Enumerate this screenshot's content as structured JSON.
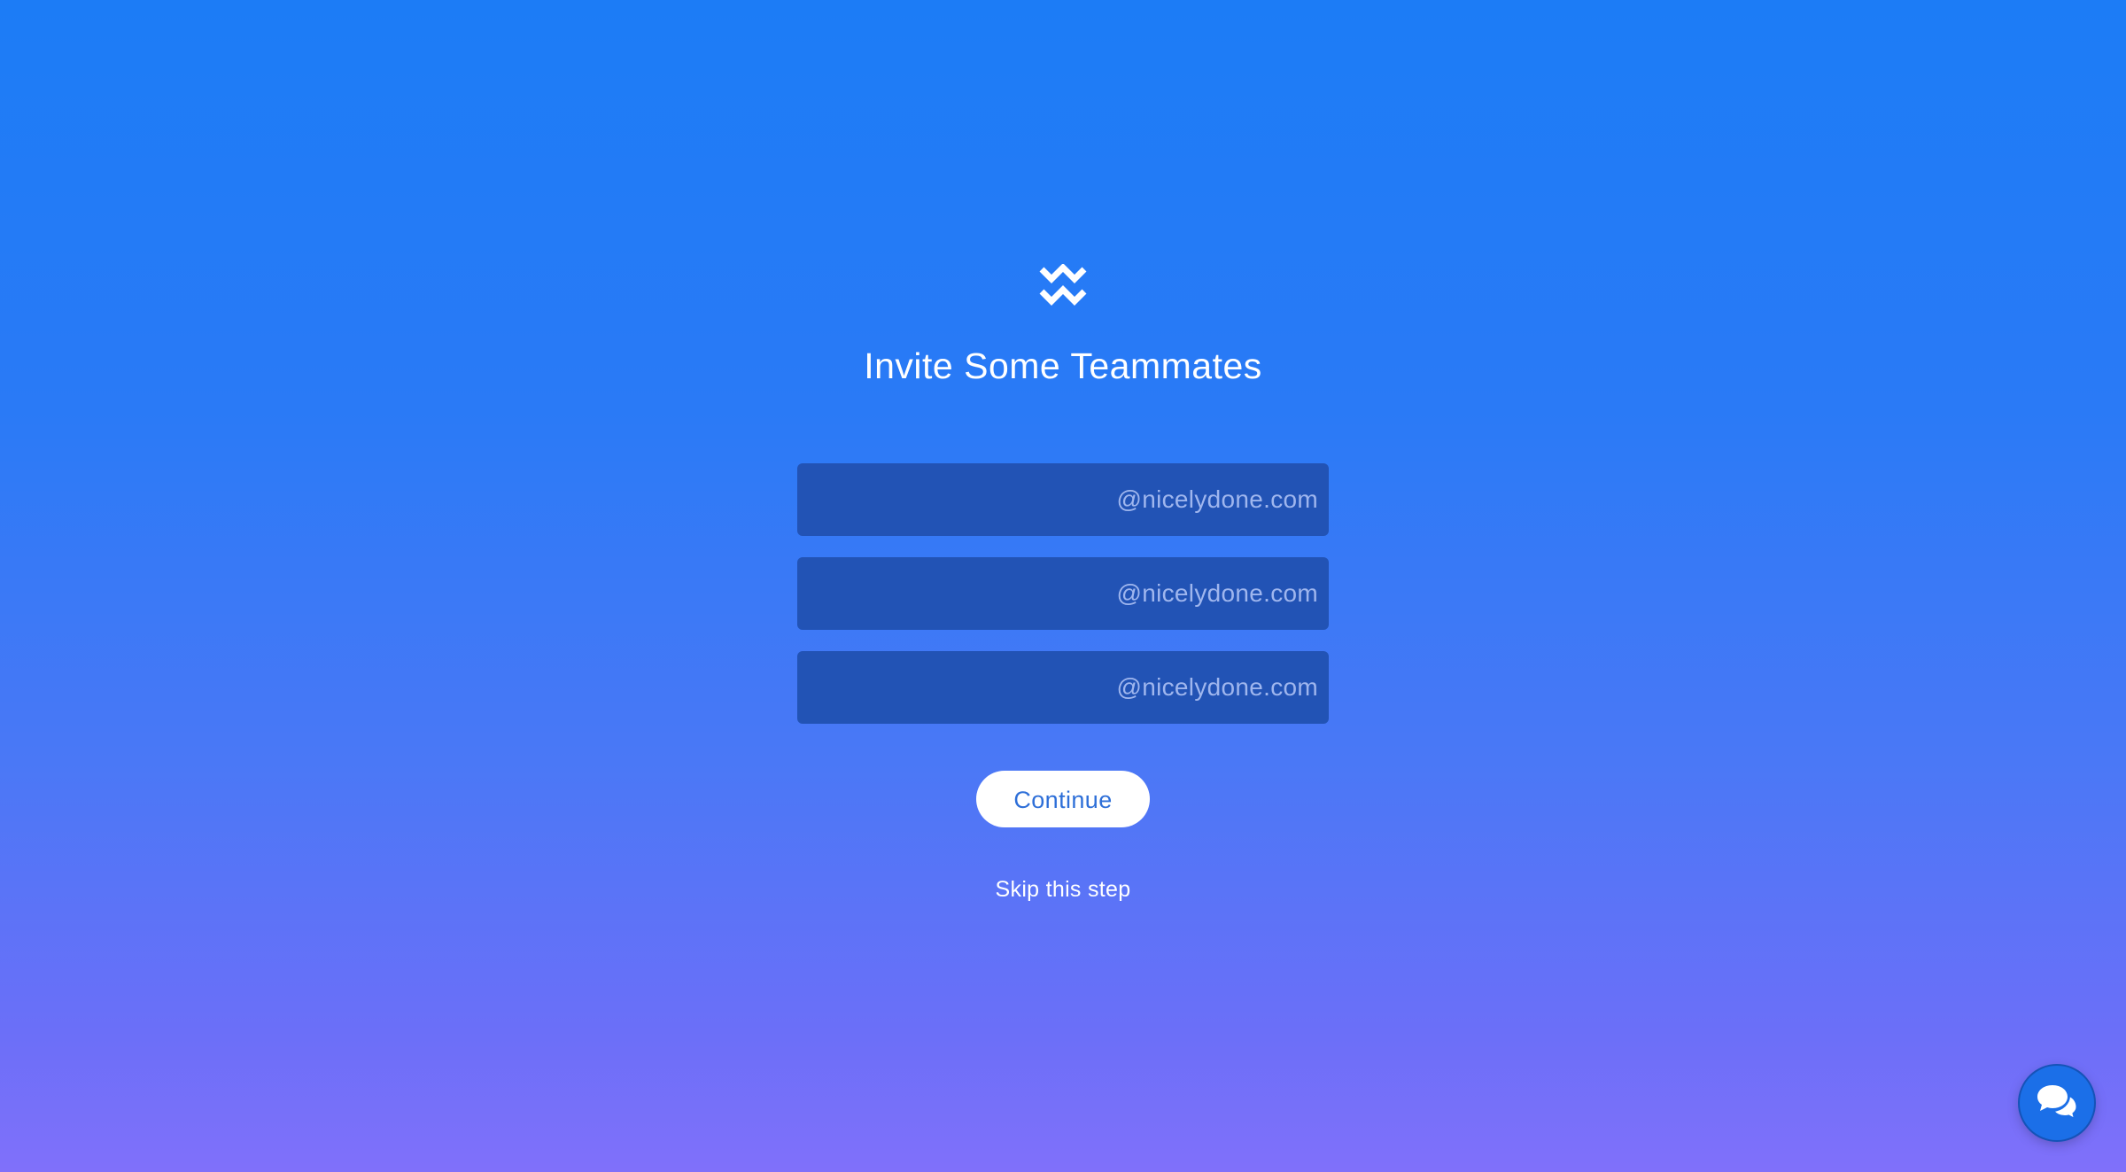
{
  "colors": {
    "background_top": "#1c7cf6",
    "background_bottom": "#8070fa",
    "input_background": "#2253b5",
    "domain_text": "#9fb6ee",
    "button_text": "#2e6fd8",
    "chat_button": "#1b6fe8"
  },
  "logo": {
    "icon": "zigzag-logo-icon"
  },
  "page": {
    "title": "Invite Some Teammates"
  },
  "invite_fields": [
    {
      "value": "",
      "placeholder": "",
      "domain_suffix": "@nicelydone.com"
    },
    {
      "value": "",
      "placeholder": "",
      "domain_suffix": "@nicelydone.com"
    },
    {
      "value": "",
      "placeholder": "",
      "domain_suffix": "@nicelydone.com"
    }
  ],
  "actions": {
    "continue_label": "Continue",
    "skip_label": "Skip this step"
  },
  "chat_widget": {
    "icon": "chat-bubbles-icon"
  }
}
